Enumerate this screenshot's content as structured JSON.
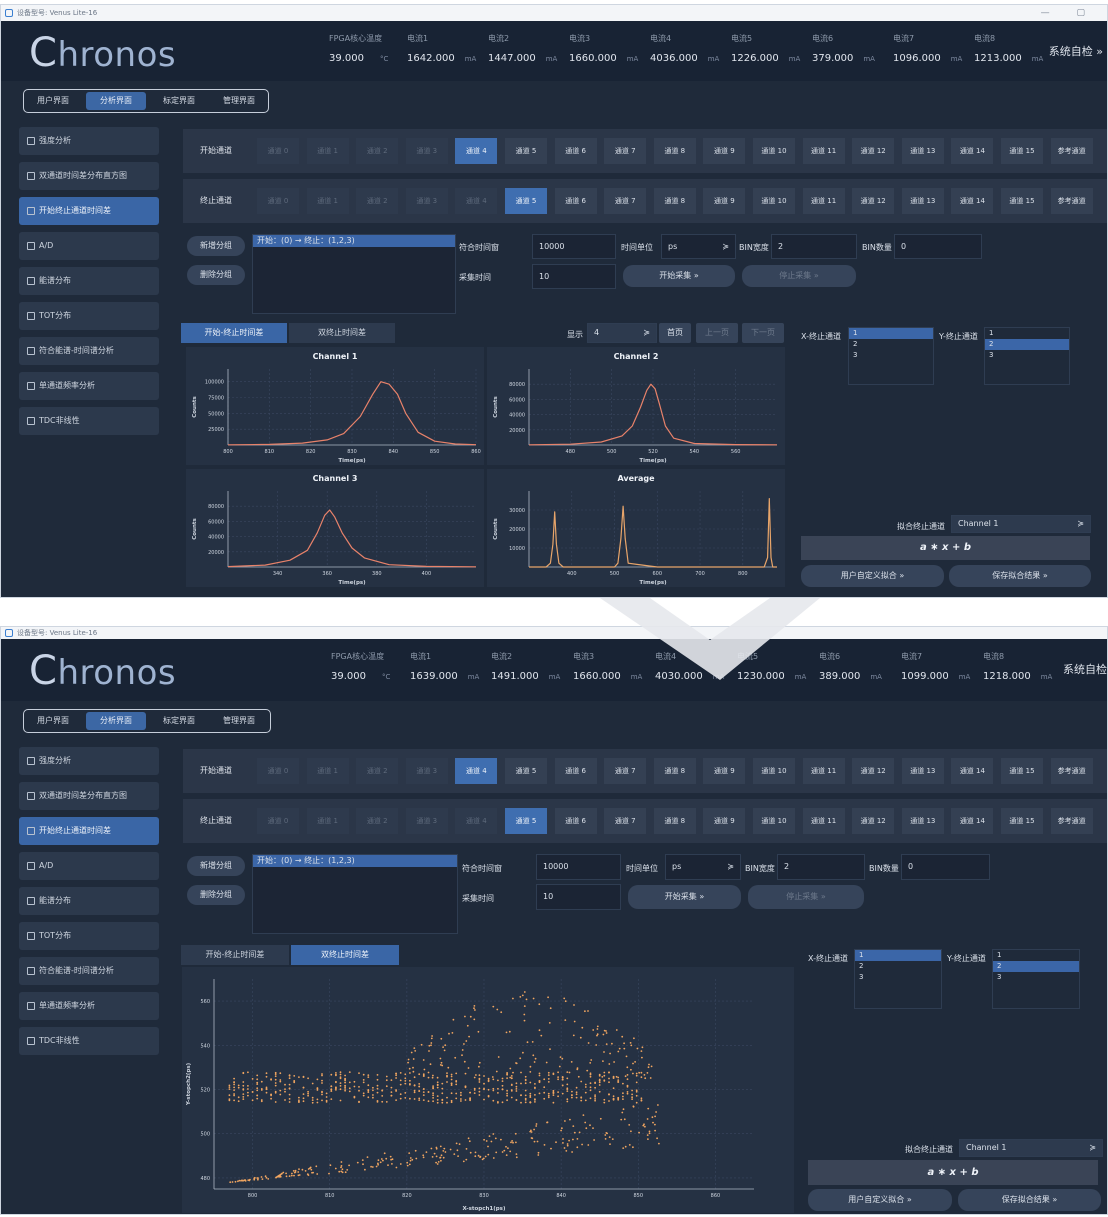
{
  "window": {
    "title": "设备型号: Venus Lite-16",
    "controls": "— ▢"
  },
  "brand": {
    "logo_c": "C",
    "logo_rest": "hronos"
  },
  "header": {
    "self_check": "系统自检 »",
    "temp_label": "FPGA核心温度",
    "temp_unit": "°C",
    "current_unit": "mA",
    "shot1": {
      "temp": "39.000",
      "currents": [
        {
          "label": "电流1",
          "value": "1642.000"
        },
        {
          "label": "电流2",
          "value": "1447.000"
        },
        {
          "label": "电流3",
          "value": "1660.000"
        },
        {
          "label": "电流4",
          "value": "4036.000"
        },
        {
          "label": "电流5",
          "value": "1226.000"
        },
        {
          "label": "电流6",
          "value": "379.000"
        },
        {
          "label": "电流7",
          "value": "1096.000"
        },
        {
          "label": "电流8",
          "value": "1213.000"
        }
      ]
    },
    "shot2": {
      "temp": "39.000",
      "currents": [
        {
          "label": "电流1",
          "value": "1639.000"
        },
        {
          "label": "电流2",
          "value": "1491.000"
        },
        {
          "label": "电流3",
          "value": "1660.000"
        },
        {
          "label": "电流4",
          "value": "4030.000"
        },
        {
          "label": "电流5",
          "value": "1230.000"
        },
        {
          "label": "电流6",
          "value": "389.000"
        },
        {
          "label": "电流7",
          "value": "1099.000"
        },
        {
          "label": "电流8",
          "value": "1218.000"
        }
      ]
    },
    "shot2_self_check": "系统自检"
  },
  "tabs": [
    "用户界面",
    "分析界面",
    "标定界面",
    "管理界面"
  ],
  "sidebar": [
    "强度分析",
    "双通道时间差分布直方图",
    "开始终止通道时间差",
    "A/D",
    "能谱分布",
    "TOT分布",
    "符合能谱-时间谱分析",
    "单通道频率分析",
    "TDC非线性"
  ],
  "channels": {
    "start_label": "开始通道",
    "stop_label": "终止通道",
    "items": [
      "通道 0",
      "通道 1",
      "通道 2",
      "通道 3",
      "通道 4",
      "通道 5",
      "通道 6",
      "通道 7",
      "通道 8",
      "通道 9",
      "通道 10",
      "通道 11",
      "通道 12",
      "通道 13",
      "通道 14",
      "通道 15",
      "参考通道"
    ]
  },
  "group": {
    "add": "新增分组",
    "delete": "删除分组",
    "entry": "开始：(0) → 终止：(1,2,3)"
  },
  "form": {
    "window_label": "符合时间窗",
    "window_value": "10000",
    "unit_label": "时间单位",
    "unit_value": "ps",
    "bin_width_label": "BIN宽度",
    "bin_width_value": "2",
    "bin_count_label": "BIN数量",
    "bin_count_value": "0",
    "acq_label": "采集时间",
    "acq_value": "10",
    "start_acq": "开始采集 »",
    "stop_acq": "停止采集 »"
  },
  "subtabs": [
    "开始-终止时间差",
    "双终止时间差"
  ],
  "paging": {
    "show_label": "显示",
    "show_value": "4",
    "first": "首页",
    "prev": "上一页",
    "next": "下一页"
  },
  "xstop": {
    "label": "X-终止通道",
    "items": [
      "1",
      "2",
      "3"
    ]
  },
  "ystop": {
    "label": "Y-终止通道",
    "items": [
      "1",
      "2",
      "3"
    ]
  },
  "fit": {
    "label": "拟合终止通道",
    "value": "Channel 1",
    "formula": "a ∗ x + b",
    "custom": "用户自定义拟合 »",
    "save": "保存拟合结果 »"
  },
  "chart_data": [
    {
      "type": "line",
      "title": "Channel 1",
      "xlabel": "Time(ps)",
      "ylabel": "Counts",
      "xlim": [
        800,
        860
      ],
      "ylim": [
        0,
        120000
      ],
      "xticks": [
        800,
        810,
        820,
        830,
        840,
        850,
        860
      ],
      "yticks": [
        25000,
        50000,
        75000,
        100000
      ],
      "x": [
        800,
        810,
        818,
        824,
        828,
        832,
        835,
        837,
        839,
        841,
        843,
        846,
        850,
        855,
        860
      ],
      "y": [
        300,
        1000,
        3000,
        8000,
        18000,
        45000,
        80000,
        100000,
        96000,
        80000,
        50000,
        20000,
        6000,
        1500,
        400
      ],
      "color": "#e8826a"
    },
    {
      "type": "line",
      "title": "Channel 2",
      "xlabel": "Time(ps)",
      "ylabel": "Counts",
      "xlim": [
        460,
        580
      ],
      "ylim": [
        0,
        100000
      ],
      "xticks": [
        480,
        500,
        520,
        540,
        560
      ],
      "yticks": [
        20000,
        40000,
        60000,
        80000
      ],
      "x": [
        460,
        480,
        495,
        505,
        510,
        514,
        517,
        519,
        521,
        523,
        526,
        530,
        540,
        560,
        580
      ],
      "y": [
        300,
        1000,
        4000,
        12000,
        25000,
        50000,
        72000,
        80000,
        74000,
        55000,
        25000,
        9000,
        2000,
        500,
        200
      ],
      "color": "#e8826a"
    },
    {
      "type": "line",
      "title": "Channel 3",
      "xlabel": "Time(ps)",
      "ylabel": "Counts",
      "xlim": [
        320,
        420
      ],
      "ylim": [
        0,
        100000
      ],
      "xticks": [
        340,
        360,
        380,
        400
      ],
      "yticks": [
        20000,
        40000,
        60000,
        80000
      ],
      "x": [
        320,
        335,
        345,
        352,
        356,
        359,
        361,
        363,
        366,
        370,
        375,
        385,
        400,
        420
      ],
      "y": [
        500,
        2500,
        9000,
        22000,
        45000,
        68000,
        75000,
        66000,
        45000,
        25000,
        12000,
        3000,
        800,
        200
      ],
      "color": "#e8826a"
    },
    {
      "type": "line",
      "title": "Average",
      "xlabel": "Time(ps)",
      "ylabel": "Counts",
      "xlim": [
        300,
        880
      ],
      "ylim": [
        0,
        40000
      ],
      "xticks": [
        400,
        500,
        600,
        700,
        800
      ],
      "yticks": [
        10000,
        20000,
        30000
      ],
      "x": [
        300,
        340,
        350,
        356,
        360,
        364,
        370,
        380,
        500,
        508,
        515,
        520,
        525,
        532,
        600,
        640,
        690,
        730,
        850,
        858,
        862,
        866,
        870,
        880
      ],
      "y": [
        0,
        0,
        2000,
        12000,
        29000,
        12000,
        2000,
        0,
        0,
        2000,
        15000,
        32000,
        15000,
        2000,
        0,
        0,
        0,
        0,
        0,
        5000,
        36000,
        5000,
        0,
        0
      ],
      "color": "#e8a56a"
    },
    {
      "type": "scatter",
      "title": "",
      "xlabel": "X-stopch1(ps)",
      "ylabel": "Y-stopch2(ps)",
      "xlim": [
        795,
        865
      ],
      "ylim": [
        475,
        570
      ],
      "xticks": [
        800,
        810,
        820,
        830,
        840,
        850,
        860
      ],
      "yticks": [
        480,
        500,
        520,
        540,
        560
      ],
      "color": "#f0a560",
      "band_y": [
        514,
        528
      ],
      "upper_cloud_y": [
        525,
        565
      ],
      "lower_cloud_y": [
        478,
        512
      ]
    }
  ]
}
